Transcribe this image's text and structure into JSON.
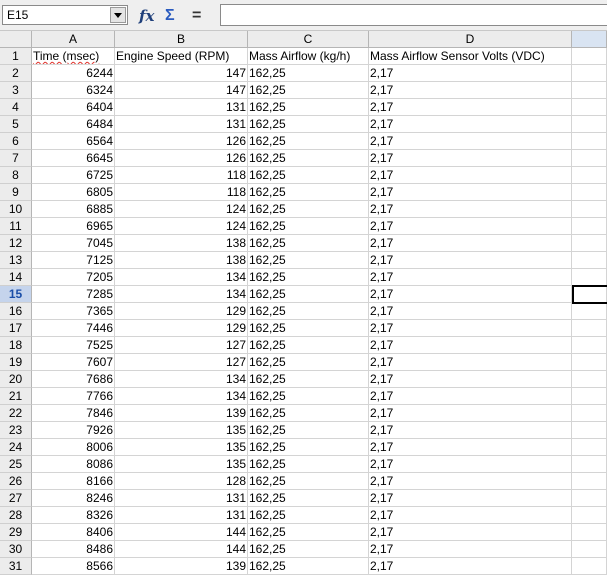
{
  "formula_bar": {
    "name_box": "E15",
    "function_wizard_glyph": "fx",
    "sum_glyph": "Σ",
    "equals_glyph": "=",
    "formula_value": ""
  },
  "sheet": {
    "columns": [
      "A",
      "B",
      "C",
      "D"
    ],
    "active_cell": "E15",
    "header_row": [
      "Time (msec)",
      "Engine Speed (RPM)",
      "Mass Airflow (kg/h)",
      "Mass Airflow Sensor Volts (VDC)"
    ],
    "rows": [
      [
        "6244",
        "147",
        "162,25",
        "2,17"
      ],
      [
        "6324",
        "147",
        "162,25",
        "2,17"
      ],
      [
        "6404",
        "131",
        "162,25",
        "2,17"
      ],
      [
        "6484",
        "131",
        "162,25",
        "2,17"
      ],
      [
        "6564",
        "126",
        "162,25",
        "2,17"
      ],
      [
        "6645",
        "126",
        "162,25",
        "2,17"
      ],
      [
        "6725",
        "118",
        "162,25",
        "2,17"
      ],
      [
        "6805",
        "118",
        "162,25",
        "2,17"
      ],
      [
        "6885",
        "124",
        "162,25",
        "2,17"
      ],
      [
        "6965",
        "124",
        "162,25",
        "2,17"
      ],
      [
        "7045",
        "138",
        "162,25",
        "2,17"
      ],
      [
        "7125",
        "138",
        "162,25",
        "2,17"
      ],
      [
        "7205",
        "134",
        "162,25",
        "2,17"
      ],
      [
        "7285",
        "134",
        "162,25",
        "2,17"
      ],
      [
        "7365",
        "129",
        "162,25",
        "2,17"
      ],
      [
        "7446",
        "129",
        "162,25",
        "2,17"
      ],
      [
        "7525",
        "127",
        "162,25",
        "2,17"
      ],
      [
        "7607",
        "127",
        "162,25",
        "2,17"
      ],
      [
        "7686",
        "134",
        "162,25",
        "2,17"
      ],
      [
        "7766",
        "134",
        "162,25",
        "2,17"
      ],
      [
        "7846",
        "139",
        "162,25",
        "2,17"
      ],
      [
        "7926",
        "135",
        "162,25",
        "2,17"
      ],
      [
        "8006",
        "135",
        "162,25",
        "2,17"
      ],
      [
        "8086",
        "135",
        "162,25",
        "2,17"
      ],
      [
        "8166",
        "128",
        "162,25",
        "2,17"
      ],
      [
        "8246",
        "131",
        "162,25",
        "2,17"
      ],
      [
        "8326",
        "131",
        "162,25",
        "2,17"
      ],
      [
        "8406",
        "144",
        "162,25",
        "2,17"
      ],
      [
        "8486",
        "144",
        "162,25",
        "2,17"
      ],
      [
        "8566",
        "139",
        "162,25",
        "2,17"
      ]
    ],
    "row_numbers": [
      "1",
      "2",
      "3",
      "4",
      "5",
      "6",
      "7",
      "8",
      "9",
      "10",
      "11",
      "12",
      "13",
      "14",
      "15",
      "16",
      "17",
      "18",
      "19",
      "20",
      "21",
      "22",
      "23",
      "24",
      "25",
      "26",
      "27",
      "28",
      "29",
      "30",
      "31"
    ]
  },
  "colors": {
    "active_row_header": "#c5d4ec",
    "selection_border": "#000000",
    "spellcheck_underline": "#e0312b"
  }
}
